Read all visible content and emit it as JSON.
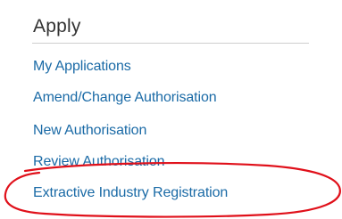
{
  "section": {
    "heading": "Apply"
  },
  "nav": {
    "items": [
      {
        "label": "My Applications"
      },
      {
        "label": "Amend/Change Authorisation"
      },
      {
        "label": "New Authorisation"
      },
      {
        "label": "Review Authorisation"
      },
      {
        "label": "Extractive Industry Registration",
        "highlighted": true
      }
    ]
  },
  "colors": {
    "link": "#1a6aa6",
    "heading": "#333333",
    "annotation": "#e0101a"
  }
}
